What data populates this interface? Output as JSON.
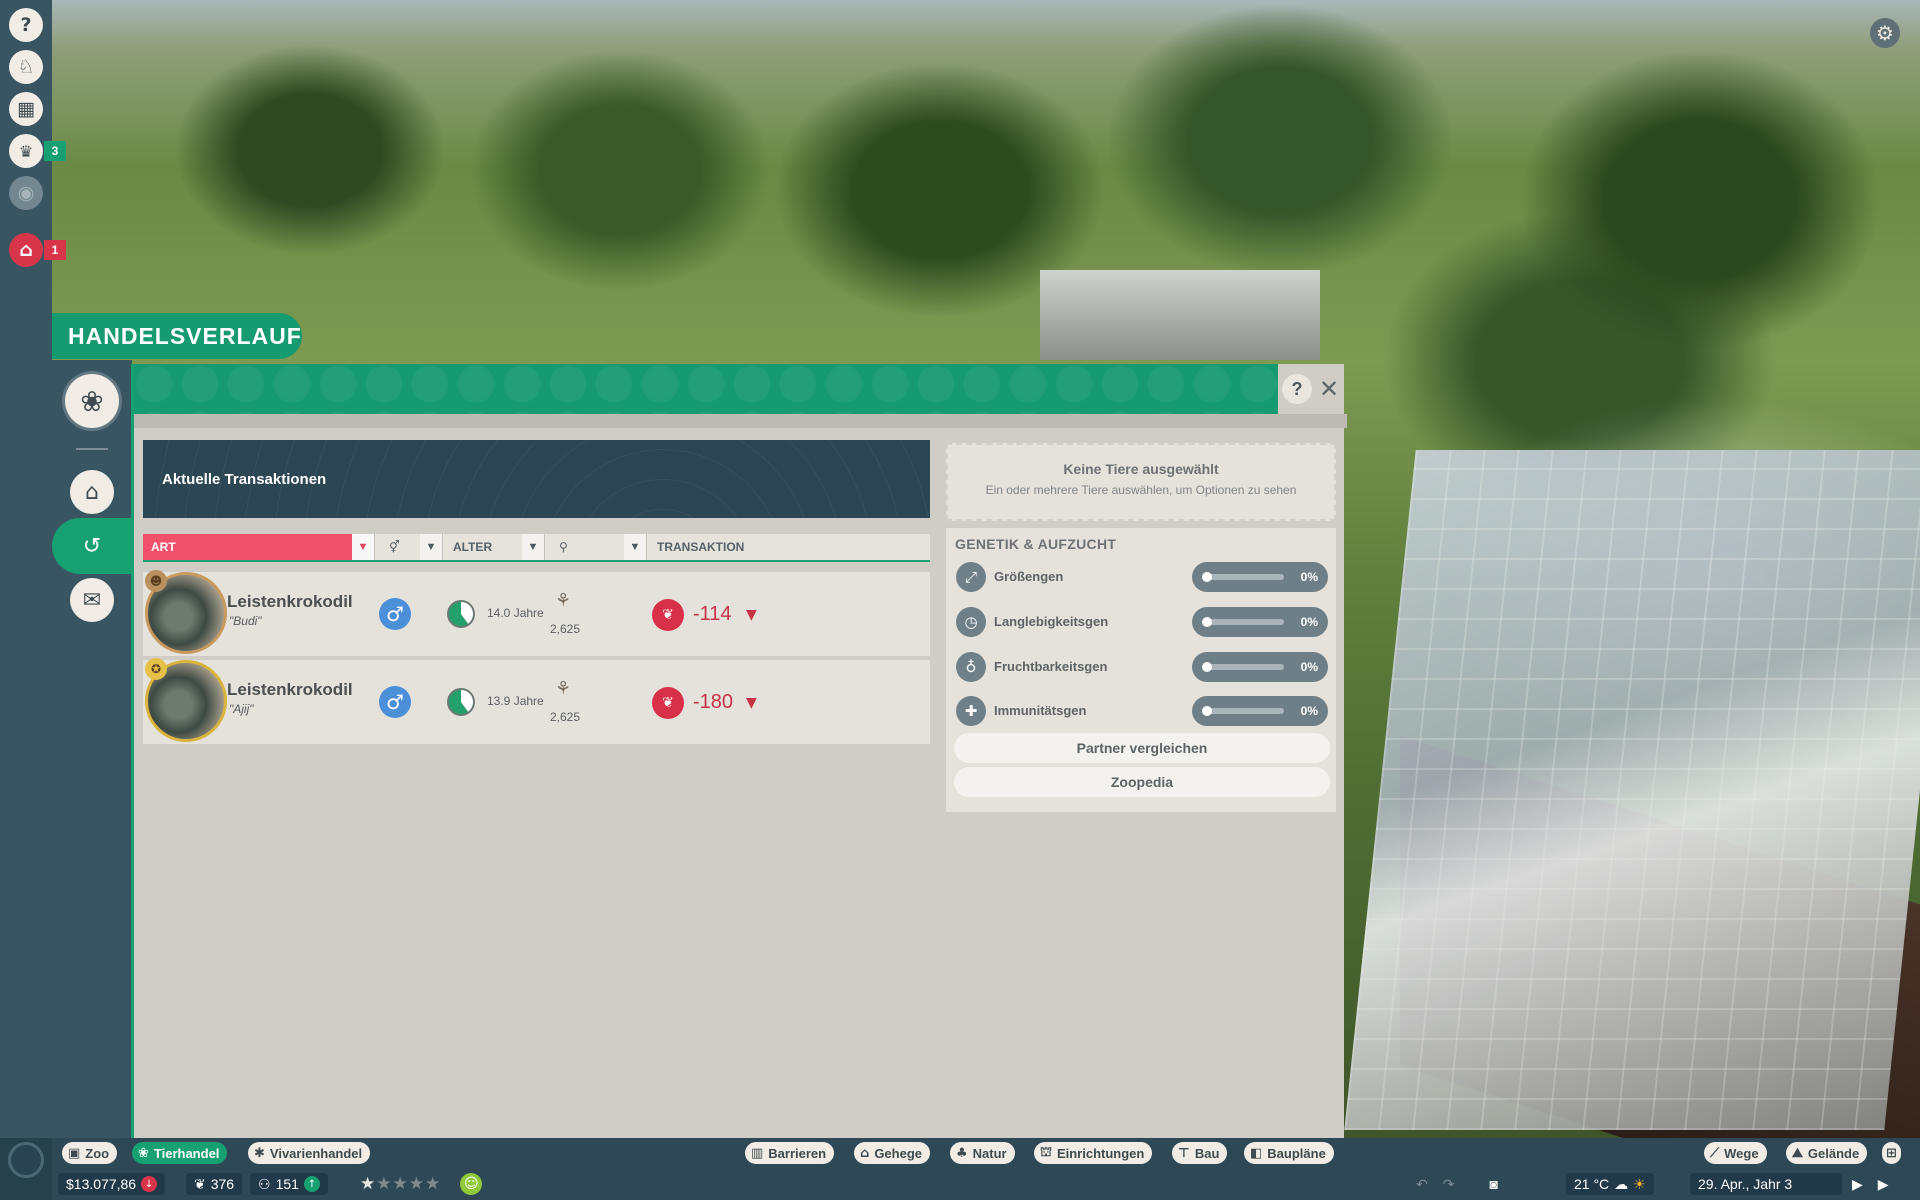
{
  "panel": {
    "title": "HANDELSVERLAUF",
    "help": "?",
    "close": "✕"
  },
  "left_rail": {
    "items": [
      {
        "name": "help",
        "glyph": "?"
      },
      {
        "name": "zoo-info",
        "glyph": "♘"
      },
      {
        "name": "calendar",
        "glyph": "▦"
      },
      {
        "name": "trophy",
        "glyph": "🏆",
        "badge": "3"
      },
      {
        "name": "view",
        "glyph": "◉"
      },
      {
        "name": "alerts",
        "glyph": "⌂",
        "badge": "1"
      }
    ]
  },
  "side_tabs": [
    "paw-icon",
    "shelter-icon",
    "history-icon",
    "gift-icon"
  ],
  "transactions": {
    "header": "Aktuelle Transaktionen",
    "columns": {
      "art": "ART",
      "sex": "⚥",
      "alter": "ALTER",
      "rep": "⚲",
      "transaktion": "TRANSAKTION"
    },
    "rows": [
      {
        "species": "Leistenkrokodil",
        "nickname": "\"Budi\"",
        "sex": "♂",
        "age": "14.0 Jahre",
        "rep": "2,625",
        "value": "-114",
        "badge": "☻"
      },
      {
        "species": "Leistenkrokodil",
        "nickname": "\"Ajij\"",
        "sex": "♂",
        "age": "13.9 Jahre",
        "rep": "2,625",
        "value": "-180",
        "badge": "✪"
      }
    ]
  },
  "details": {
    "no_selection_title": "Keine Tiere ausgewählt",
    "no_selection_sub": "Ein oder mehrere Tiere auswählen, um Optionen zu sehen",
    "genetics_title": "GENETIK & AUFZUCHT",
    "genes": [
      {
        "label": "Größengen",
        "value": "0%",
        "glyph": "⤢"
      },
      {
        "label": "Langlebigkeitsgen",
        "value": "0%",
        "glyph": "◷"
      },
      {
        "label": "Fruchtbarkeitsgen",
        "value": "0%",
        "glyph": "♁"
      },
      {
        "label": "Immunitätsgen",
        "value": "0%",
        "glyph": "✚"
      }
    ],
    "compare_button": "Partner vergleichen",
    "zoopedia_button": "Zoopedia"
  },
  "bottom_nav": {
    "left": [
      {
        "label": "Zoo",
        "icon": "▣"
      },
      {
        "label": "Tierhandel",
        "icon": "❀"
      },
      {
        "label": "Vivarienhandel",
        "icon": "✱"
      }
    ],
    "center": [
      {
        "label": "Barrieren",
        "icon": "▥"
      },
      {
        "label": "Gehege",
        "icon": "⌂"
      },
      {
        "label": "Natur",
        "icon": "♣"
      },
      {
        "label": "Einrichtungen",
        "icon": "⛫"
      },
      {
        "label": "Bau",
        "icon": "⊤"
      },
      {
        "label": "Baupläne",
        "icon": "◧"
      }
    ],
    "right": [
      {
        "label": "Wege",
        "icon": "⟋"
      },
      {
        "label": "Gelände",
        "icon": "⛰"
      }
    ]
  },
  "status": {
    "money": "$13.077,86",
    "conservation": "376",
    "guests": "151",
    "rating_stars": 1,
    "rating_max": 5,
    "temperature": "21 °C",
    "date": "29. Apr., Jahr 3"
  },
  "colors": {
    "accent": "#17a071",
    "art_filter": "#f0506a",
    "negative": "#c63349",
    "male": "#4a8fd8"
  }
}
